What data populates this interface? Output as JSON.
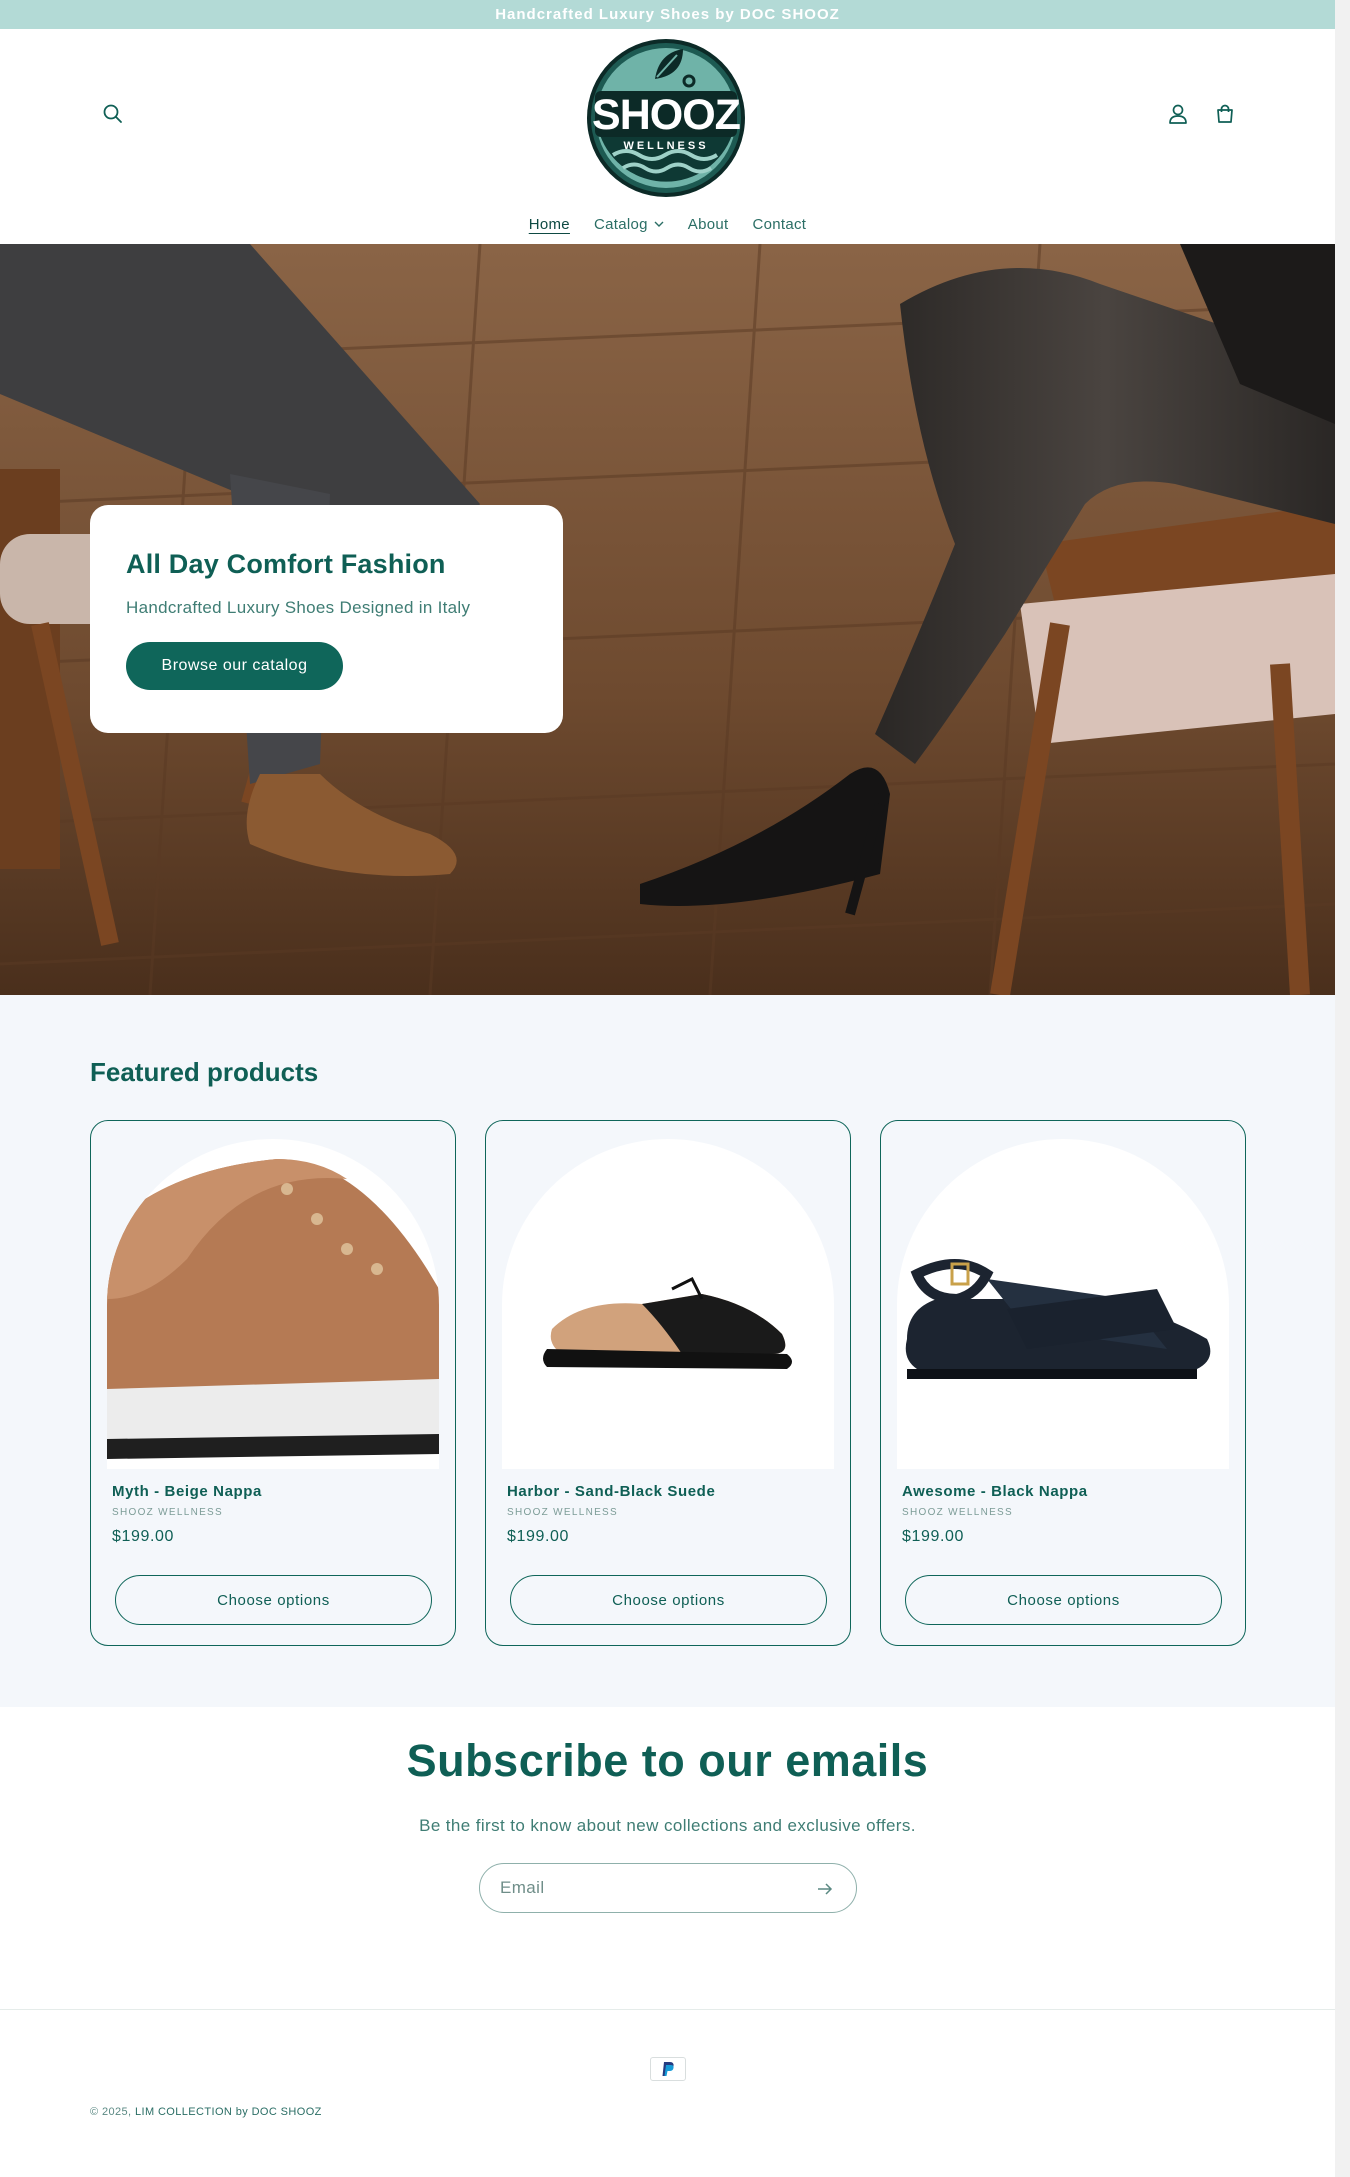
{
  "announcement": "Handcrafted Luxury Shoes by DOC SHOOZ",
  "header": {
    "logo_main": "SHOOZ",
    "logo_sub": "WELLNESS",
    "icons": {
      "search": "search-icon",
      "account": "user-icon",
      "cart": "cart-icon"
    }
  },
  "nav": {
    "items": [
      {
        "label": "Home"
      },
      {
        "label": "Catalog"
      },
      {
        "label": "About"
      },
      {
        "label": "Contact"
      }
    ]
  },
  "hero": {
    "title": "All Day Comfort Fashion",
    "subtitle": "Handcrafted Luxury Shoes Designed in Italy",
    "button": "Browse our catalog"
  },
  "featured": {
    "title": "Featured products",
    "products": [
      {
        "name": "Myth - Beige Nappa",
        "vendor": "SHOOZ WELLNESS",
        "price": "$199.00",
        "button": "Choose options"
      },
      {
        "name": "Harbor - Sand-Black Suede",
        "vendor": "SHOOZ WELLNESS",
        "price": "$199.00",
        "button": "Choose options"
      },
      {
        "name": "Awesome - Black Nappa",
        "vendor": "SHOOZ WELLNESS",
        "price": "$199.00",
        "button": "Choose options"
      }
    ]
  },
  "subscribe": {
    "title": "Subscribe to our emails",
    "text": "Be the first to know about new collections and exclusive offers.",
    "placeholder": "Email"
  },
  "footer": {
    "payment": "paypal-icon",
    "copyright_prefix": "© 2025,",
    "copyright_link": "LIM COLLECTION by DOC SHOOZ"
  },
  "colors": {
    "brand": "#0f5f55",
    "button": "#0f665a",
    "announcement_bg": "#b3dad6",
    "section_bg": "#f4f7fb"
  }
}
